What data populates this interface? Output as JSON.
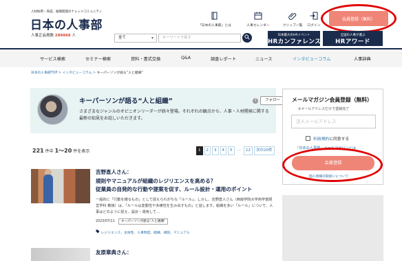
{
  "header": {
    "tagline": "人材採用・育成、組織開発のナレッジコミュニティ",
    "logo": "日本の人事部",
    "members_label": "人事正会員数",
    "members_count": "289866",
    "members_unit": "人",
    "nav": [
      {
        "label": "「日本の人事部」とは",
        "icon": "book-icon"
      },
      {
        "label": "人事カレンダー",
        "icon": "calendar-icon"
      },
      {
        "label": "クリップ一覧",
        "icon": "paperclip-icon"
      },
      {
        "label": "ログイン",
        "icon": "login-icon"
      }
    ],
    "register_button": "会員登録（無料）",
    "search_category": "全て",
    "search_placeholder": "キーワードで探す",
    "banners": [
      {
        "small": "日本最大のHRイベント",
        "big": "HRカンファレンス"
      },
      {
        "small": "全国の人事が選ぶ",
        "big": "HRアワード"
      }
    ]
  },
  "global_nav": {
    "items": [
      "サービス検索",
      "セミナー検索",
      "資料・書式交換",
      "Q&A",
      "調査レポート",
      "ニュース",
      "インタビューコラム",
      "人事辞典"
    ],
    "active_index": 6
  },
  "breadcrumb": {
    "items": [
      "日本の人事部TOP",
      "インタビューコラム"
    ],
    "current": "キーパーソンが語る“人と組織”"
  },
  "column": {
    "title": "キーパーソンが語る“人と組織”",
    "follow": "フォロー",
    "help": "?",
    "desc": "さまざまなジャンルのオピニオンリーダーが続々登場。それぞれの観点から、人事・人材開発に関する最新の知見をお話しいただきます。"
  },
  "results": {
    "total": "221",
    "suffix": "件中",
    "range": "1〜20",
    "range_suffix": "件を表示"
  },
  "pager": {
    "pages": [
      "1",
      "2",
      "3",
      "4",
      "5",
      "12"
    ],
    "ellipsis": "…",
    "next": "次の20件"
  },
  "article": {
    "name": "吉野直人さん：",
    "title_line1": "規則やマニュアルが組織のレジリエンスを高める？",
    "title_line2": "従業員の自発的な行動や提案を促す、ルール設計・運用のポイント",
    "body": "一般的に「行動を縛るもの」として捉えられがちな「ルール」。しかし、吉野直人さん（西南学院大学商学部経営学科 教授）は、「ルールは変動性や多様性を生み出すもの」と話します。組織を多い「ルール」について、人事はどのように捉え、設計・運用して…",
    "date": "2023/07/11",
    "tag": "キーパーソンが語る“人と組織”",
    "keywords": "レジリエンス、主体性、人事制度、組織、規則、マニュアル"
  },
  "article2": {
    "name": "友原章典さん："
  },
  "mailmag": {
    "title": "メールマガジン会員登録（無料）",
    "sub": "※メールアドレスだけで登録完了",
    "email_placeholder": "法人メールアドレス",
    "agree_link": "利用規約",
    "agree_text": "に同意する",
    "link": "『日本の人事部』メールマガジンとは",
    "button": "会員登録",
    "foot": "個人情報の取扱いについて"
  },
  "colors": {
    "navy": "#1a2b4c",
    "accent": "#ef8577",
    "highlight": "#e00000",
    "link": "#2d6fa6",
    "active_nav": "#2d8ab8",
    "card_bg": "#e8f3f4"
  }
}
